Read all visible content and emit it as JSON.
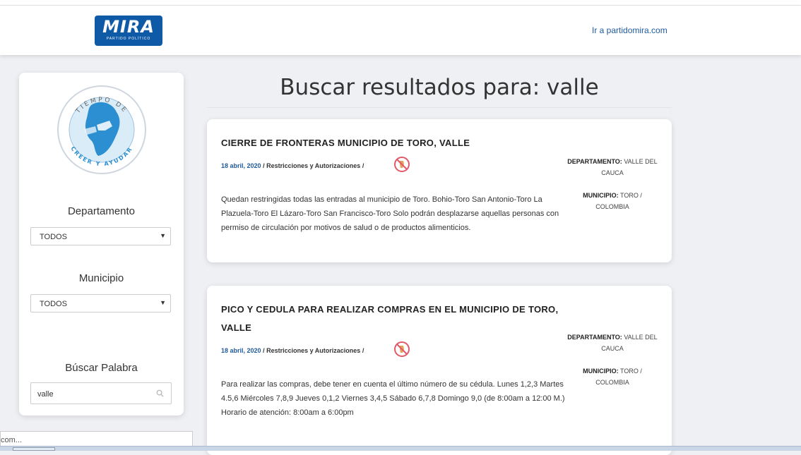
{
  "header": {
    "logo_text": "MIRA",
    "logo_subtext": "PARTIDO POLÍTICO",
    "link": "Ir a partidomira.com"
  },
  "sidebar": {
    "emblem_text_top": "TIEMPO DE",
    "emblem_text_bottom": "CREER Y AYUDAR",
    "departamento_label": "Departamento",
    "departamento_value": "TODOS",
    "municipio_label": "Municipio",
    "municipio_value": "TODOS",
    "buscar_label": "Búscar Palabra",
    "search_value": "valle"
  },
  "page_title": "Buscar resultados para: valle",
  "results": [
    {
      "title": "CIERRE DE FRONTERAS MUNICIPIO DE TORO, VALLE",
      "date": "18 abril, 2020",
      "category": "Restricciones y Autorizaciones",
      "excerpt": "Quedan restringidas todas las entradas al municipio de Toro. Bohio-Toro San Antonio-Toro La Plazuela-Toro El Lázaro-Toro San Francisco-Toro Solo podrán desplazarse aquellas personas con permiso de circulación por motivos de salud o de productos alimenticios.",
      "dep_label": "DEPARTAMENTO:",
      "dep_value": "VALLE DEL CAUCA",
      "mun_label": "MUNICIPIO:",
      "mun_value": "TORO / COLOMBIA"
    },
    {
      "title": "PICO Y CEDULA PARA REALIZAR COMPRAS EN EL MUNICIPIO DE TORO, VALLE",
      "date": "18 abril, 2020",
      "category": "Restricciones y Autorizaciones",
      "excerpt": "Para realizar las compras, debe tener en cuenta el último número de su cédula. Lunes 1,2,3 Martes 4.5,6 Miércoles 7,8,9 Jueves 0,1,2 Viernes 3,4,5 Sábado 6,7,8 Domingo 9,0 (de 8:00am a 12:00 M.) Horario de atención: 8:00am a 6:00pm",
      "dep_label": "DEPARTAMENTO:",
      "dep_value": "VALLE DEL CAUCA",
      "mun_label": "MUNICIPIO:",
      "mun_value": "TORO / COLOMBIA"
    }
  ],
  "meta_separator": "/",
  "bottom_strip_text": "com...",
  "colors": {
    "brand": "#0f5aa6",
    "link": "#1f5a9a",
    "no_icon": "#e05a6a"
  }
}
